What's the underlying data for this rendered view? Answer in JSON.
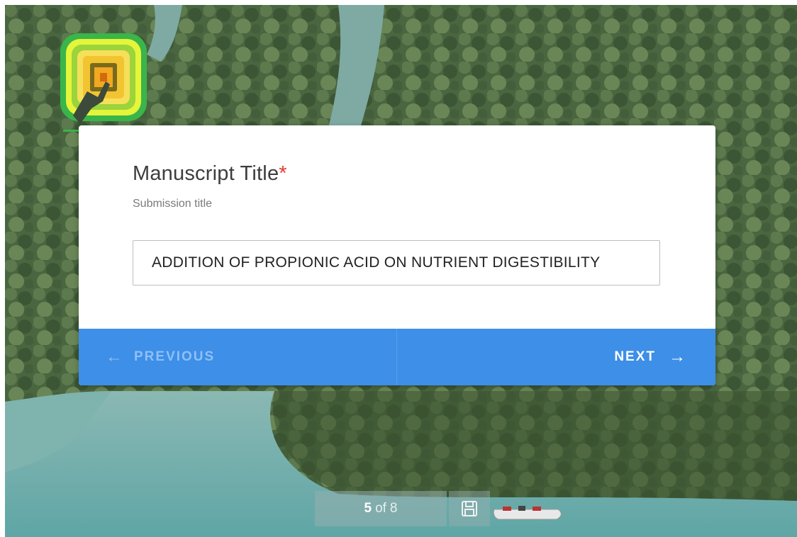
{
  "question": {
    "title": "Manuscript Title",
    "required_marker": "*",
    "subtitle": "Submission title",
    "answer_value": "ADDITION OF PROPIONIC ACID ON NUTRIENT DIGESTIBILITY"
  },
  "navigation": {
    "previous_label": "PREVIOUS",
    "next_label": "NEXT"
  },
  "progress": {
    "current": "5",
    "of_word": "of",
    "total": "8"
  },
  "icons": {
    "previous": "arrow-left-icon",
    "next": "arrow-right-icon",
    "save": "save-icon",
    "logo": "concentric-squares-logo"
  },
  "colors": {
    "nav_bar": "#3d8fe8",
    "required": "#e53935",
    "previous_text": "#8fc0f6",
    "next_text": "#ffffff"
  }
}
